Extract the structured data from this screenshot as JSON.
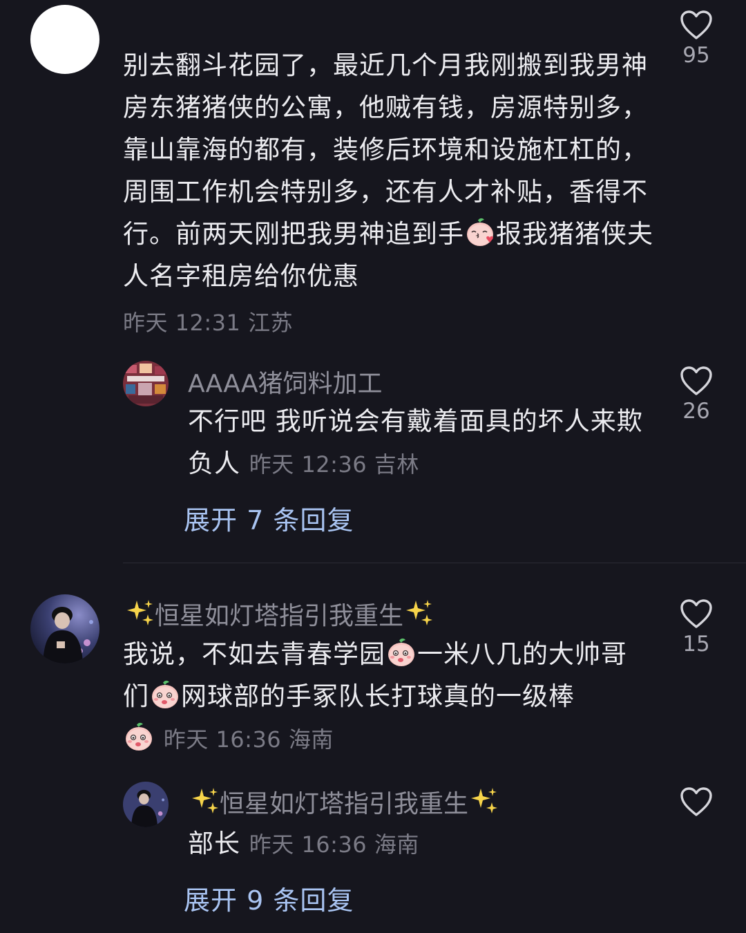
{
  "comments": [
    {
      "text_part1": "别去翻斗花园了，最近几个月我刚搬到我男神房东猪猪侠的公寓，他贼有钱，房源特别多，靠山靠海的都有，装修后环境和设施杠杠的，周围工作机会特别多，还有人才补贴，香得不行。前两天刚把我男神追到手",
      "text_part2": "报我猪猪侠夫人名字租房给你优惠",
      "meta": "昨天 12:31 江苏",
      "likes": "95",
      "reply": {
        "username": "AAAA猪饲料加工",
        "text": "不行吧 我听说会有戴着面具的坏人来欺负人",
        "meta": "昨天 12:36 吉林",
        "likes": "26"
      },
      "expand_label": "展开 7 条回复"
    },
    {
      "username": "恒星如灯塔指引我重生",
      "text_part1": "我说，不如去青春学园",
      "text_part2": "一米八几的大帅哥们",
      "text_part3": "网球部的手冢队长打球真的一级棒",
      "meta": "昨天 16:36 海南",
      "likes": "15",
      "reply": {
        "username": "恒星如灯塔指引我重生",
        "text": "部长",
        "meta": "昨天 16:36 海南",
        "likes": ""
      },
      "expand_label": "展开 9 条回复"
    }
  ],
  "icons": {
    "like": "heart-outline-icon",
    "emoji": "peach-face-emoji",
    "sparkle": "sparkles-emoji"
  },
  "colors": {
    "background": "#16161e",
    "text": "#ececf0",
    "meta": "#7b7b86",
    "link": "#a9c4f2"
  }
}
